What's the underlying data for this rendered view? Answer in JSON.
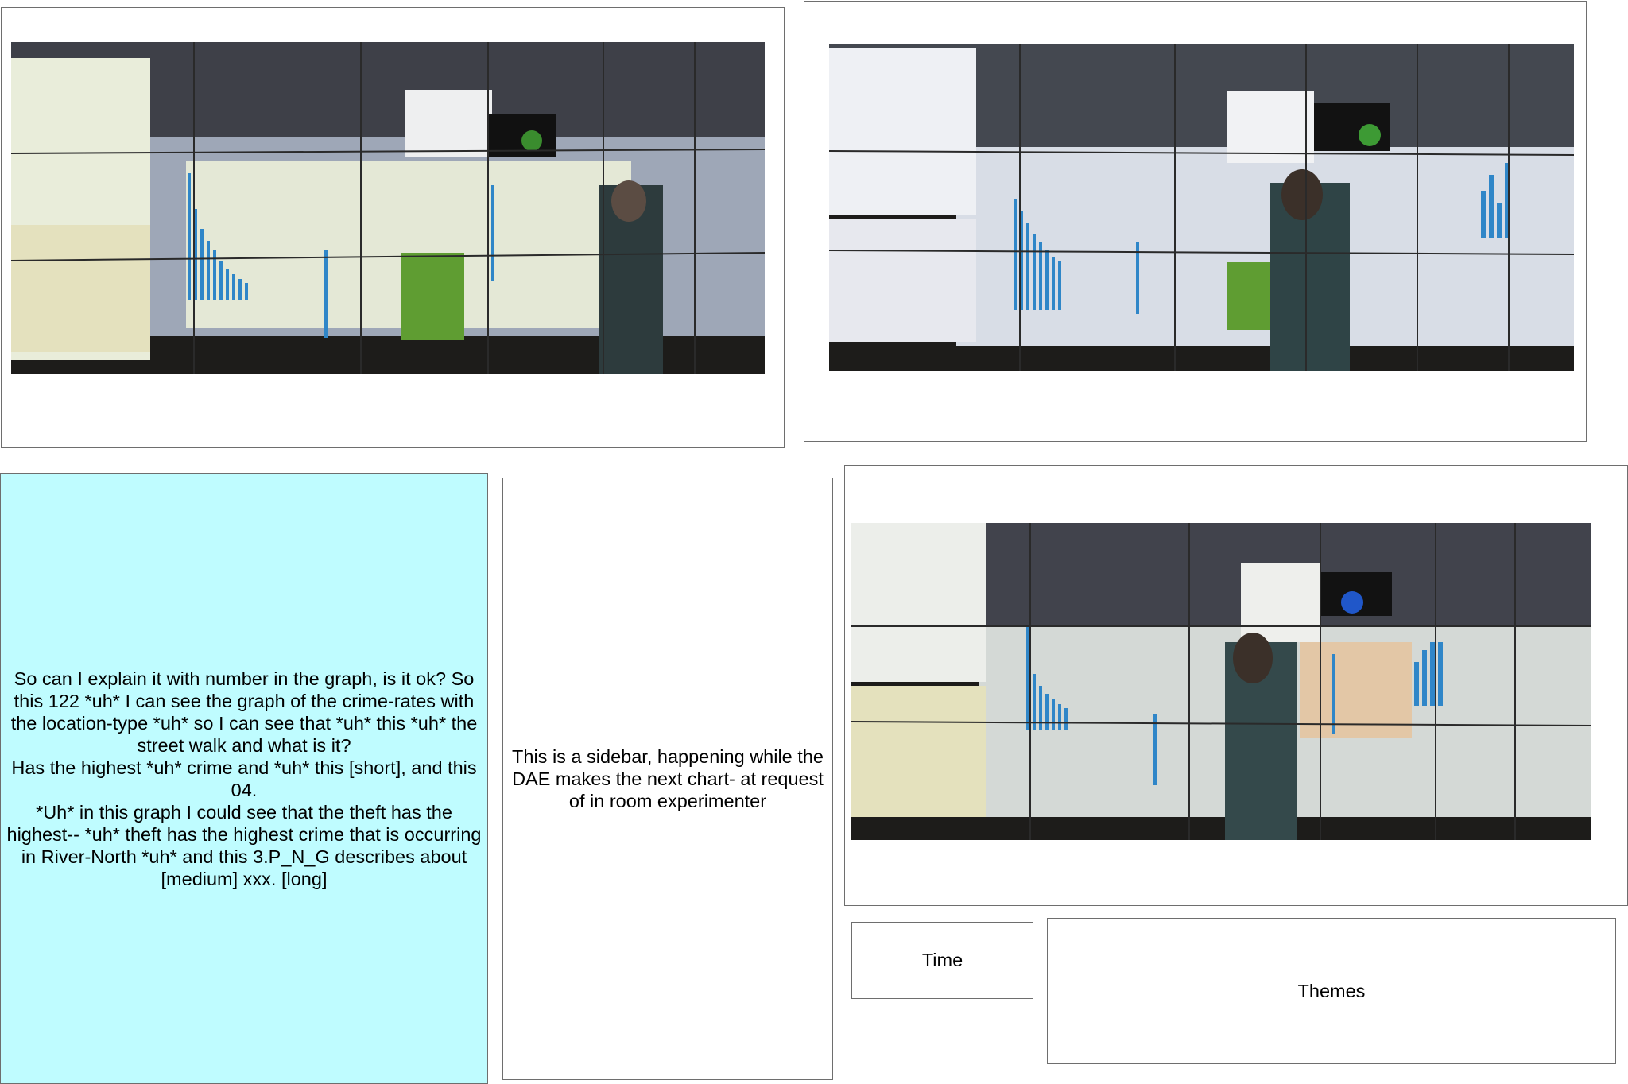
{
  "photos": [
    {
      "caption_hint": "",
      "content": "photo-wall-1"
    },
    {
      "caption_hint": "",
      "content": "photo-wall-2"
    },
    {
      "caption_hint": "",
      "content": "photo-wall-3"
    }
  ],
  "transcript": {
    "lines": [
      "So can I explain it with number in the graph, is it ok? So this 122 *uh* I can see the graph of the crime-rates with the location-type *uh* so I can see that *uh* this *uh* the street walk and what is it?",
      "Has the highest *uh* crime and *uh* this [short], and this 04.",
      "*Uh* in this graph I could see that the theft has the highest-- *uh* theft has the highest crime that is occurring in River-North *uh* and this 3.P_N_G describes about [medium] xxx. [long]"
    ]
  },
  "sidebar_note": {
    "text": "This is a sidebar, happening while the DAE makes the next chart- at request of in room experimenter"
  },
  "time_box": {
    "label": "Time"
  },
  "themes_box": {
    "label": "Themes"
  },
  "colors": {
    "transcript_bg": "#bffcff",
    "border": "#6e6e6e",
    "bar_blue": "#2f86c8",
    "green_panel": "#5f9d32"
  }
}
